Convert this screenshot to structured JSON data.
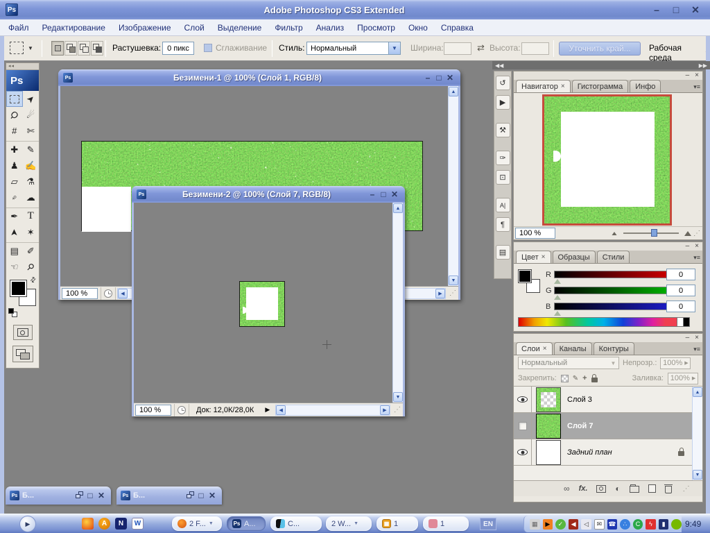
{
  "window": {
    "title": "Adobe Photoshop CS3 Extended",
    "logo": "Ps"
  },
  "menu": {
    "items": [
      "Файл",
      "Редактирование",
      "Изображение",
      "Слой",
      "Выделение",
      "Фильтр",
      "Анализ",
      "Просмотр",
      "Окно",
      "Справка"
    ]
  },
  "options": {
    "feather_label": "Растушевка:",
    "feather_value": "0 пикс",
    "antialias_label": "Сглаживание",
    "style_label": "Стиль:",
    "style_value": "Нормальный",
    "width_label": "Ширина:",
    "height_label": "Высота:",
    "refine_label": "Уточнить край...",
    "workspace_label": "Рабочая среда"
  },
  "toolbar": {
    "logo": "Ps",
    "tools": [
      {
        "name": "move",
        "glyph": "➤"
      },
      {
        "name": "lasso",
        "glyph": "Ϙ"
      },
      {
        "name": "magic-wand",
        "glyph": "☄"
      },
      {
        "name": "crop",
        "glyph": "#"
      },
      {
        "name": "slice",
        "glyph": "✄"
      },
      {
        "name": "healing-brush",
        "glyph": "✚"
      },
      {
        "name": "brush",
        "glyph": "✎"
      },
      {
        "name": "clone-stamp",
        "glyph": "♟"
      },
      {
        "name": "history-brush",
        "glyph": "✍"
      },
      {
        "name": "eraser",
        "glyph": "▱"
      },
      {
        "name": "paint-bucket",
        "glyph": "⚗"
      },
      {
        "name": "dodge",
        "glyph": "♀"
      },
      {
        "name": "sponge",
        "glyph": "☁"
      },
      {
        "name": "pen",
        "glyph": "✒"
      },
      {
        "name": "type",
        "glyph": "T"
      },
      {
        "name": "path-select",
        "glyph": "➤"
      },
      {
        "name": "shape",
        "glyph": "✶"
      },
      {
        "name": "notes",
        "glyph": "▤"
      },
      {
        "name": "eyedropper",
        "glyph": "✐"
      },
      {
        "name": "hand",
        "glyph": "☜"
      },
      {
        "name": "zoom",
        "glyph": "⚲"
      }
    ]
  },
  "dock_strip": {
    "icons": [
      "↺",
      "▶",
      "⚒",
      "✑",
      "⊡",
      "A|",
      "¶",
      "▤"
    ]
  },
  "docs": {
    "doc1": {
      "title": "Безимени-1 @ 100% (Слой 1, RGB/8)",
      "zoom": "100 %"
    },
    "doc2": {
      "title": "Безимени-2 @ 100% (Слой 7, RGB/8)",
      "zoom": "100 %",
      "size_info": "Док: 12,0К/28,0К"
    },
    "minimized": [
      {
        "title": "Б..."
      },
      {
        "title": "Б..."
      }
    ]
  },
  "panels": {
    "navigator": {
      "tabs": [
        "Навигатор",
        "Гистограмма",
        "Инфо"
      ],
      "zoom_value": "100 %"
    },
    "color": {
      "tabs": [
        "Цвет",
        "Образцы",
        "Стили"
      ],
      "channels": [
        {
          "label": "R",
          "value": "0"
        },
        {
          "label": "G",
          "value": "0"
        },
        {
          "label": "B",
          "value": "0"
        }
      ]
    },
    "layers": {
      "tabs": [
        "Слои",
        "Каналы",
        "Контуры"
      ],
      "blend_mode": "Нормальный",
      "opacity_label": "Непрозр.:",
      "opacity_value": "100%",
      "lock_label": "Закрепить:",
      "fill_label": "Заливка:",
      "fill_value": "100%",
      "fx_label": "fx.",
      "items": [
        {
          "name": "Слой 3"
        },
        {
          "name": "Слой 7"
        },
        {
          "name": "Задний план"
        }
      ]
    }
  },
  "taskbar": {
    "tasks": [
      {
        "label": "2 F..."
      },
      {
        "label": "A..."
      },
      {
        "label": "C..."
      },
      {
        "label": "2 W..."
      },
      {
        "label": "1"
      },
      {
        "label": "1"
      }
    ],
    "language": "EN",
    "clock": "9:49"
  },
  "colors": {
    "accent_blue": "#7e95d8",
    "workspace_gray": "#828282",
    "navigator_border": "#c64b3c"
  }
}
